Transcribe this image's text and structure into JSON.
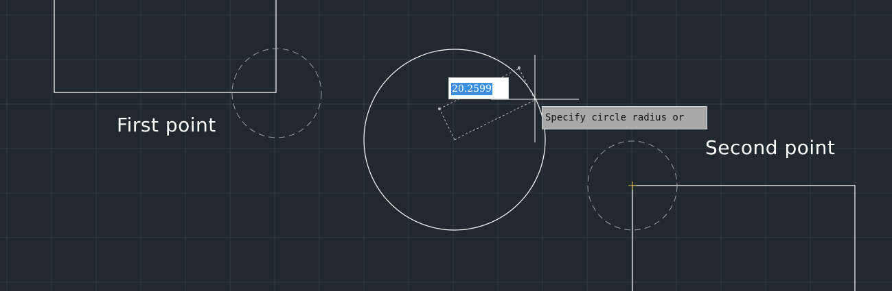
{
  "labels": {
    "first_point": "First point",
    "second_point": "Second point"
  },
  "dynamic_input": {
    "value": "20.2599"
  },
  "tooltip": {
    "text": "Specify circle radius or"
  },
  "colors": {
    "background": "#212830",
    "grid": "#2e3a45",
    "geometry": "#ffffff",
    "preview": "#9aa0a8",
    "selection": "#3a8fe0",
    "tooltip_bg": "#a9a9a9",
    "snap_marker": "#f0c040"
  }
}
